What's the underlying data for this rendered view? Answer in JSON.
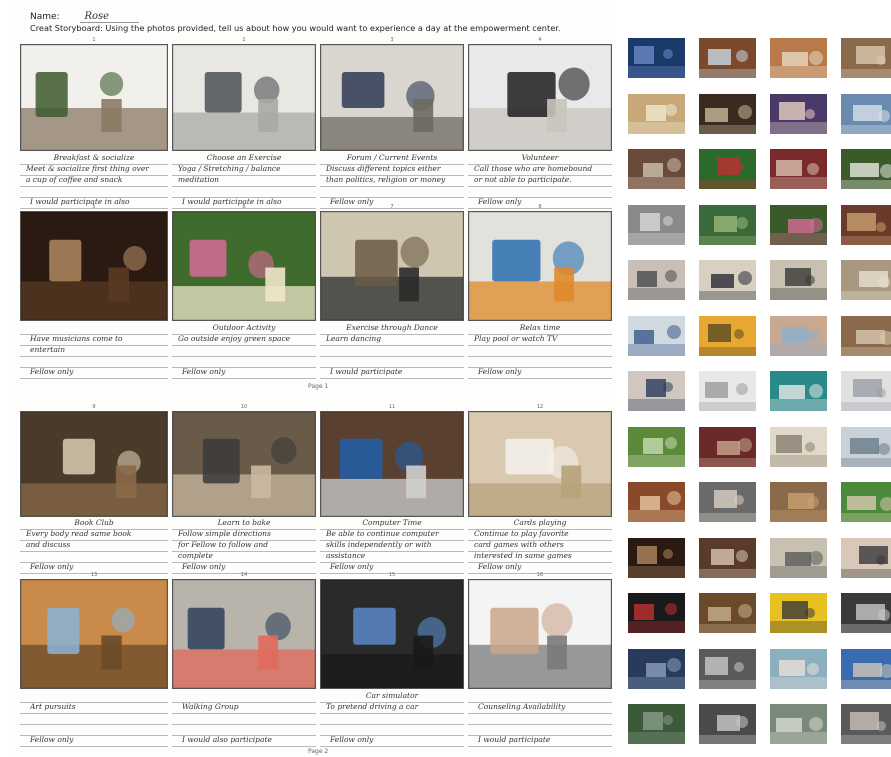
{
  "header": {
    "name_label": "Name:",
    "name_value": "Rose",
    "prompt": "Creat Storyboard: Using the photos provided, tell us about how you would want to experience a day at the empowerment center."
  },
  "page_labels": [
    "Page 1",
    "Page 2"
  ],
  "panels": [
    {
      "number": "1",
      "title": "Breakfast & socialize",
      "lines": [
        "Meet & socialize first thing over",
        "a cup of coffee and snack"
      ],
      "answer": "I would participate in also",
      "colors": [
        "#f2f0ec",
        "#3d5a2e",
        "#8a7a66"
      ]
    },
    {
      "number": "2",
      "title": "Choose an Exercise",
      "lines": [
        "Yoga / Stretching / balance",
        "meditation"
      ],
      "answer": "I would participate in also",
      "colors": [
        "#e9e7e2",
        "#4b4f55",
        "#a9a9a6"
      ]
    },
    {
      "number": "3",
      "title": "Forum / Current Events",
      "lines": [
        "Discuss different topics either",
        "than politics, religion or money"
      ],
      "answer": "Fellow only",
      "colors": [
        "#d9d6cf",
        "#2e3a55",
        "#6f6a62"
      ]
    },
    {
      "number": "4",
      "title": "Volunteer",
      "lines": [
        "Call those who are homebound",
        "or not able to participate."
      ],
      "answer": "Fellow only",
      "colors": [
        "#e8e9ea",
        "#1f1f22",
        "#c9c4bd"
      ]
    },
    {
      "number": "5",
      "title": "",
      "lines": [
        "Have musicians come to",
        "entertain"
      ],
      "answer": "Fellow only",
      "colors": [
        "#2a1a12",
        "#b08860",
        "#5a3a24"
      ]
    },
    {
      "number": "6",
      "title": "Outdoor Activity",
      "lines": [
        "Go outside enjoy green space",
        ""
      ],
      "answer": "Fellow only",
      "colors": [
        "#3f6b2c",
        "#d86a96",
        "#efe6c8"
      ]
    },
    {
      "number": "7",
      "title": "Exercise through Dance",
      "lines": [
        "Learn dancing",
        ""
      ],
      "answer": "I would participate",
      "colors": [
        "#cfc6b2",
        "#6b5b45",
        "#2b2b2b"
      ]
    },
    {
      "number": "8",
      "title": "Relax time",
      "lines": [
        "Play pool or watch TV",
        ""
      ],
      "answer": "Fellow only",
      "colors": [
        "#e3e1dc",
        "#2a6fb0",
        "#e08a2a"
      ]
    },
    {
      "number": "9",
      "title": "Book Club",
      "lines": [
        "Every body read same book",
        "and discuss"
      ],
      "answer": "Fellow only",
      "colors": [
        "#4a3a2a",
        "#d8ccb0",
        "#8a6a48"
      ]
    },
    {
      "number": "10",
      "title": "Learn to bake",
      "lines": [
        "Follow simple directions",
        "for Fellow to follow and",
        "complete"
      ],
      "answer": "Fellow only",
      "colors": [
        "#6a5a4a",
        "#3a3a3a",
        "#c9b9a0"
      ]
    },
    {
      "number": "11",
      "title": "Computer Time",
      "lines": [
        "Be able to continue computer",
        "skills independently or with",
        "assistance"
      ],
      "answer": "Fellow only",
      "colors": [
        "#5a4030",
        "#1e5fa8",
        "#cfcfcf"
      ]
    },
    {
      "number": "12",
      "title": "Cards playing",
      "lines": [
        "Continue to play favorite",
        "card games with others",
        "interested in same games"
      ],
      "answer": "Fellow only",
      "colors": [
        "#d9c9b0",
        "#f5f2ec",
        "#b8a27c"
      ]
    },
    {
      "number": "13",
      "title": "",
      "lines": [
        "Art pursuits",
        ""
      ],
      "answer": "Fellow only",
      "colors": [
        "#c98a4a",
        "#8ab4d8",
        "#6a4a2a"
      ]
    },
    {
      "number": "14",
      "title": "",
      "lines": [
        "Walking Group",
        ""
      ],
      "answer": "I would also participate",
      "colors": [
        "#b8b4ac",
        "#2e3f5a",
        "#e06a5a"
      ]
    },
    {
      "number": "15",
      "title": "Car simulator",
      "lines": [
        "To pretend driving a car",
        ""
      ],
      "answer": "Fellow only",
      "colors": [
        "#2a2a2a",
        "#5a8ac8",
        "#1a1a1a"
      ]
    },
    {
      "number": "16",
      "title": "",
      "lines": [
        "Counseling Availability",
        ""
      ],
      "answer": "I would participate",
      "colors": [
        "#f4f4f4",
        "#c9a48a",
        "#7a7a7a"
      ]
    }
  ],
  "thumbnails": [
    {
      "colors": [
        "#1a3a6a",
        "#6a8ac8"
      ]
    },
    {
      "colors": [
        "#7a4a2a",
        "#c8d8e8"
      ]
    },
    {
      "colors": [
        "#b87a4a",
        "#e8d8c0"
      ]
    },
    {
      "colors": [
        "#8a6a4a",
        "#d8c8b0"
      ]
    },
    {
      "colors": [
        "#c8a878",
        "#f0e8d0"
      ]
    },
    {
      "colors": [
        "#3a2a20",
        "#c8b89a"
      ]
    },
    {
      "colors": [
        "#4a3a6a",
        "#e8d0c0"
      ]
    },
    {
      "colors": [
        "#6a8ab0",
        "#d8e0e8"
      ]
    },
    {
      "colors": [
        "#6a4a3a",
        "#d0c0b0"
      ]
    },
    {
      "colors": [
        "#2a6a2a",
        "#c03030"
      ]
    },
    {
      "colors": [
        "#7a2a2a",
        "#d8c0b0"
      ]
    },
    {
      "colors": [
        "#3a5a2a",
        "#e8e8e0"
      ]
    },
    {
      "colors": [
        "#8a8a8a",
        "#d8d8d8"
      ]
    },
    {
      "colors": [
        "#3a6a3a",
        "#9ab87a"
      ]
    },
    {
      "colors": [
        "#3a5a2a",
        "#d86a96"
      ]
    },
    {
      "colors": [
        "#6a3a2a",
        "#c8a070"
      ]
    },
    {
      "colors": [
        "#c8c0b8",
        "#4a4a4a"
      ]
    },
    {
      "colors": [
        "#d8d0c0",
        "#2a2a3a"
      ]
    },
    {
      "colors": [
        "#c8c0b0",
        "#3a3a3a"
      ]
    },
    {
      "colors": [
        "#a89880",
        "#e8e0d0"
      ]
    },
    {
      "colors": [
        "#d0d8e0",
        "#3a5a8a"
      ]
    },
    {
      "colors": [
        "#e8a830",
        "#5a4a20"
      ]
    },
    {
      "colors": [
        "#c8a890",
        "#8ab0d0"
      ]
    },
    {
      "colors": [
        "#8a6a4a",
        "#d8c8b0"
      ]
    },
    {
      "colors": [
        "#d0c8c0",
        "#2a3a5a"
      ]
    },
    {
      "colors": [
        "#e8e8e8",
        "#9a9a9a"
      ]
    },
    {
      "colors": [
        "#2a8a8a",
        "#e8e8e8"
      ]
    },
    {
      "colors": [
        "#e0e0e0",
        "#9aa0a8"
      ]
    },
    {
      "colors": [
        "#5a8a3a",
        "#c8d8b0"
      ]
    },
    {
      "colors": [
        "#6a2a2a",
        "#c8a890"
      ]
    },
    {
      "colors": [
        "#e0d8c8",
        "#8a8070"
      ]
    },
    {
      "colors": [
        "#c8d0d8",
        "#6a7a8a"
      ]
    },
    {
      "colors": [
        "#8a4a2a",
        "#e8c8a0"
      ]
    },
    {
      "colors": [
        "#6a6a6a",
        "#d8d0c0"
      ]
    },
    {
      "colors": [
        "#8a6a4a",
        "#c8a070"
      ]
    },
    {
      "colors": [
        "#4a8a3a",
        "#d8c8b0"
      ]
    },
    {
      "colors": [
        "#2a1a12",
        "#b08860"
      ]
    },
    {
      "colors": [
        "#5a3a2a",
        "#d8c8b0"
      ]
    },
    {
      "colors": [
        "#c8c0b0",
        "#5a5a5a"
      ]
    },
    {
      "colors": [
        "#d8c8b8",
        "#3a3a3a"
      ]
    },
    {
      "colors": [
        "#1a1a1a",
        "#c03030"
      ]
    },
    {
      "colors": [
        "#6a4a2a",
        "#c8b090"
      ]
    },
    {
      "colors": [
        "#e8c020",
        "#3a3a3a"
      ]
    },
    {
      "colors": [
        "#3a3a3a",
        "#c8c8c8"
      ]
    },
    {
      "colors": [
        "#2a3a5a",
        "#8aa0c0"
      ]
    },
    {
      "colors": [
        "#5a5a5a",
        "#c8c8c8"
      ]
    },
    {
      "colors": [
        "#8ab0c0",
        "#e8e0d8"
      ]
    },
    {
      "colors": [
        "#3a6ab0",
        "#d0c8b8"
      ]
    },
    {
      "colors": [
        "#3a5a3a",
        "#8a9a8a"
      ]
    },
    {
      "colors": [
        "#4a4a4a",
        "#c8c8c8"
      ]
    },
    {
      "colors": [
        "#7a8a7a",
        "#d8d8d0"
      ]
    },
    {
      "colors": [
        "#5a5a5a",
        "#c8c0b8"
      ]
    }
  ]
}
